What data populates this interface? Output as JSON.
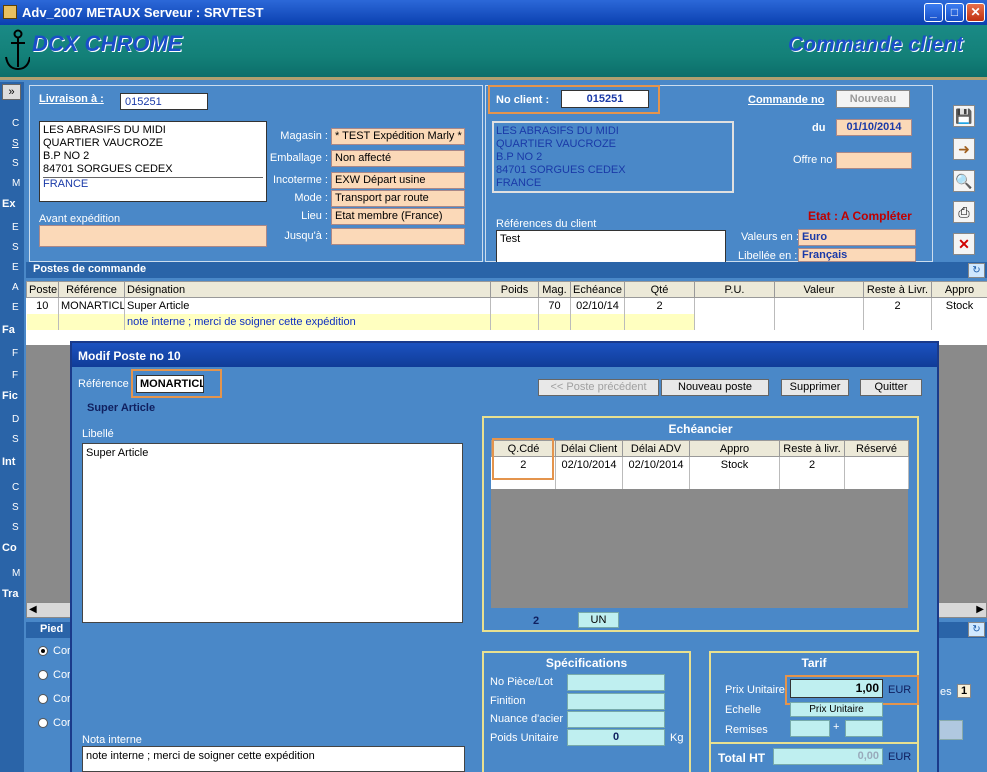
{
  "window": {
    "title": "Adv_2007 METAUX   Serveur : SRVTEST"
  },
  "banner": {
    "logo": "DCX CHROME",
    "title": "Commande client"
  },
  "left_strip": {
    "toggle": "»",
    "sections": [
      "Ex",
      "Fa",
      "Fic",
      "Int",
      "Co",
      "Tra"
    ]
  },
  "livraison": {
    "label": "Livraison à :",
    "code": "015251",
    "address": [
      "LES ABRASIFS DU MIDI",
      "QUARTIER VAUCROZE",
      "B.P NO 2",
      "84701 SORGUES CEDEX"
    ],
    "country": "FRANCE",
    "avant_expedition_label": "Avant expédition",
    "fields": [
      {
        "label": "Magasin :",
        "value": "* TEST Expédition Marly *"
      },
      {
        "label": "Emballage :",
        "value": "Non affecté"
      },
      {
        "label": "Incoterme :",
        "value": "EXW  Départ usine"
      },
      {
        "label": "Mode :",
        "value": "Transport par route"
      },
      {
        "label": "Lieu :",
        "value": "Etat membre (France)"
      },
      {
        "label": "Jusqu'à :",
        "value": ""
      }
    ]
  },
  "client": {
    "label": "No client :",
    "code": "015251",
    "address": [
      "LES ABRASIFS DU MIDI",
      "QUARTIER VAUCROZE",
      "B.P NO 2",
      "84701 SORGUES CEDEX",
      "FRANCE"
    ],
    "ref_label": "Références du client",
    "ref_value": "Test"
  },
  "commande": {
    "no_label": "Commande no",
    "no_value": "Nouveau",
    "du_label": "du",
    "date": "01/10/2014",
    "offre_label": "Offre no",
    "offre_value": "",
    "etat": "Etat : A Compléter",
    "valeurs_label": "Valeurs en :",
    "valeurs_value": "Euro",
    "libellee_label": "Libellée en :",
    "libellee_value": "Français"
  },
  "postes": {
    "header": "Postes de commande",
    "columns": [
      "Poste",
      "Référence",
      "Désignation",
      "Poids",
      "Mag.",
      "Echéance",
      "Qté",
      "P.U.",
      "Valeur",
      "Reste à Livr.",
      "Appro"
    ],
    "row": {
      "poste": "10",
      "reference": "MONARTICLE",
      "designation": "Super Article",
      "poids": "",
      "mag": "70",
      "echeance": "02/10/14",
      "qte": "2",
      "pu": "",
      "valeur": "",
      "reste": "2",
      "appro": "Stock"
    },
    "note": "note interne ; merci de soigner cette expédition"
  },
  "pied": {
    "label": "Pied",
    "radios": [
      "Cor",
      "Cor",
      "Cor",
      "Cor"
    ]
  },
  "modal": {
    "title": "Modif Poste no 10",
    "ref_label": "Référence",
    "ref_value": "MONARTICL",
    "article_name": "Super Article",
    "buttons": {
      "prev": "<< Poste précédent",
      "new": "Nouveau poste",
      "delete": "Supprimer",
      "quit": "Quitter"
    },
    "libelle_label": "Libellé",
    "libelle_value": "Super Article",
    "nota_label": "Nota interne",
    "nota_value": "note interne ; merci de soigner cette expédition",
    "echeancier": {
      "title": "Echéancier",
      "columns": [
        "Q.Cdé",
        "Délai Client",
        "Délai ADV",
        "Appro",
        "Reste à livr.",
        "Réservé"
      ],
      "rows": [
        {
          "qcde": "2",
          "delai_client": "02/10/2014",
          "delai_adv": "02/10/2014",
          "appro": "Stock",
          "reste": "2",
          "reserve": ""
        }
      ],
      "total": "2",
      "unit": "UN"
    },
    "specifications": {
      "title": "Spécifications",
      "fields": [
        {
          "label": "No Pièce/Lot",
          "value": ""
        },
        {
          "label": "Finition",
          "value": ""
        },
        {
          "label": "Nuance d'acier",
          "value": ""
        },
        {
          "label": "Poids Unitaire",
          "value": "0"
        }
      ],
      "poids_unit": "Kg"
    },
    "tarif": {
      "title": "Tarif",
      "prix_label": "Prix Unitaire",
      "prix_value": "1,00",
      "currency": "EUR",
      "echelle_label": "Echelle",
      "echelle_value": "Prix Unitaire",
      "remises_label": "Remises",
      "plus": "+",
      "total_label": "Total HT",
      "total_value": "0,00"
    }
  },
  "right_fragment": {
    "es_label": "es",
    "count": "1"
  }
}
